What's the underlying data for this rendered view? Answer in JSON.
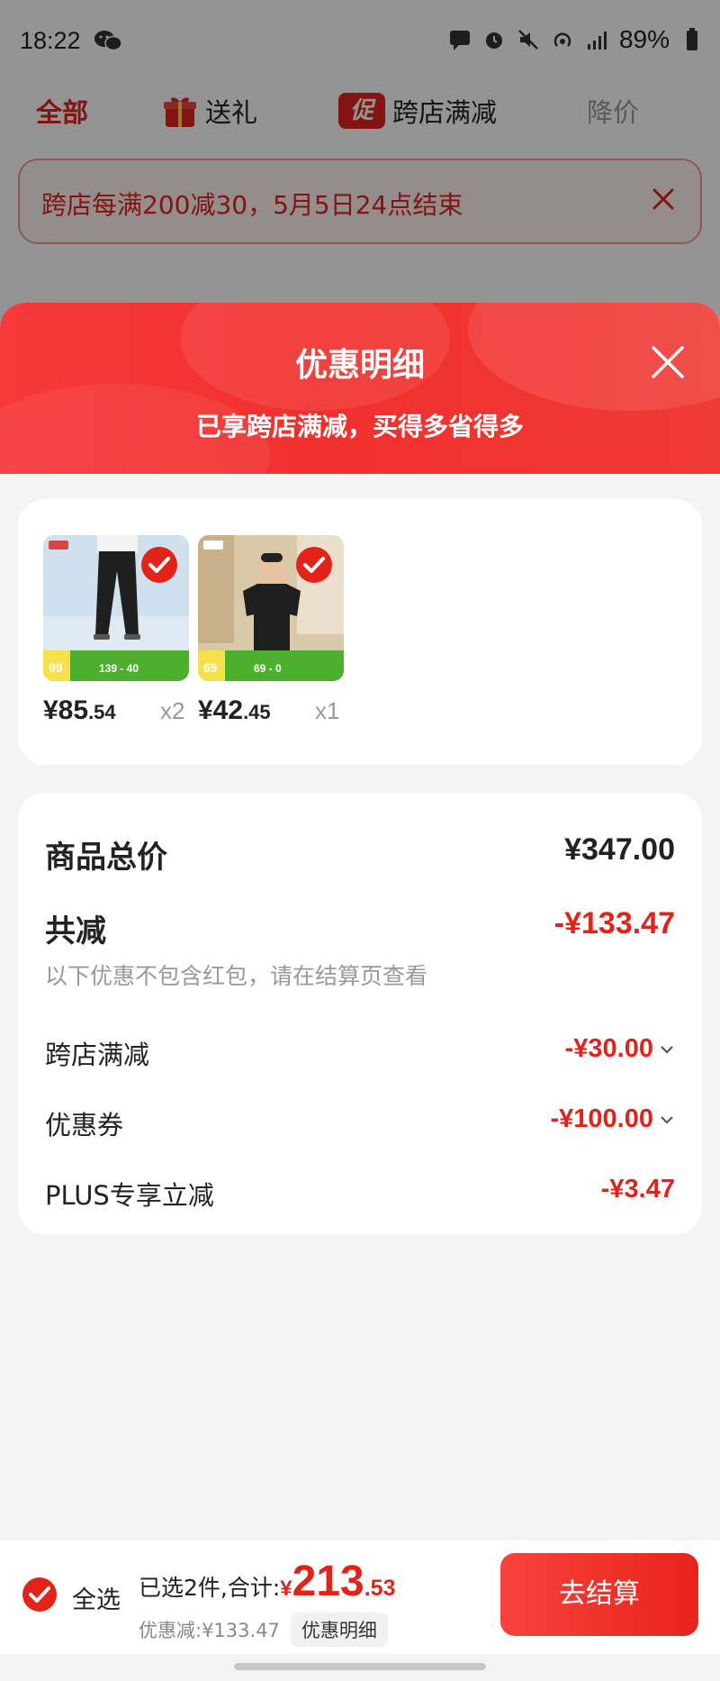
{
  "status_bar": {
    "time": "18:22",
    "battery": "89%"
  },
  "tabs": [
    {
      "label": "全部"
    },
    {
      "label": "送礼"
    },
    {
      "label": "跨店满减",
      "badge": "促"
    },
    {
      "label": "降价"
    }
  ],
  "notice": {
    "text": "跨店每满200减30，5月5日24点结束"
  },
  "sheet": {
    "title": "优惠明细",
    "subtitle": "已享跨店满减，买得多省得多"
  },
  "products": [
    {
      "price_int": "¥85",
      "price_dec": ".54",
      "qty": "x2",
      "banner_left": "99",
      "banner_mid": "139 - 40"
    },
    {
      "price_int": "¥42",
      "price_dec": ".45",
      "qty": "x1",
      "banner_left": "69",
      "banner_mid": "69 - 0"
    }
  ],
  "summary": {
    "total_label": "商品总价",
    "total_value": "¥347.00",
    "reduce_label": "共减",
    "reduce_value": "-¥133.47",
    "note": "以下优惠不包含红包，请在结算页查看",
    "items": [
      {
        "label": "跨店满减",
        "value": "-¥30.00",
        "expandable": true
      },
      {
        "label": "优惠券",
        "value": "-¥100.00",
        "expandable": true
      },
      {
        "label": "PLUS专享立减",
        "value": "-¥3.47",
        "expandable": false
      }
    ]
  },
  "bottom_bar": {
    "select_all": "全选",
    "total_prefix": "已选2件,合计:",
    "total_yen": "¥",
    "total_int": "213",
    "total_dec": ".53",
    "discount_text": "优惠减:¥133.47",
    "detail_button": "优惠明细",
    "checkout_button": "去结算"
  },
  "colors": {
    "accent": "#e2231a",
    "header_red": "#f1302e",
    "muted": "#999999"
  },
  "icons": [
    "wechat-icon",
    "gift-icon",
    "close-icon",
    "check-circle-icon",
    "chevron-down-icon"
  ]
}
